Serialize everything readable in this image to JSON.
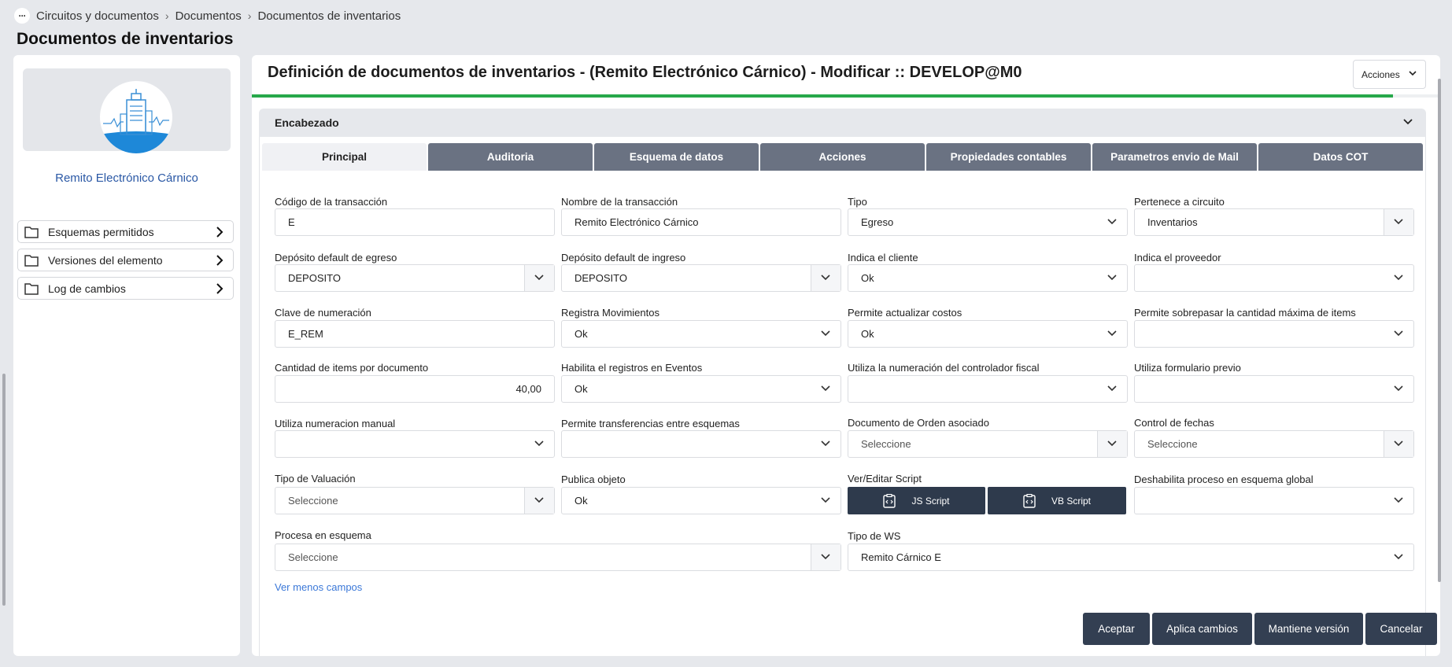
{
  "breadcrumb": {
    "menu_icon": "ellipsis-icon",
    "items": [
      "Circuitos y documentos",
      "Documentos",
      "Documentos de inventarios"
    ]
  },
  "page_title": "Documentos de inventarios",
  "sidebar": {
    "element_name": "Remito Electrónico Cárnico",
    "items": [
      {
        "label": "Esquemas permitidos",
        "icon": "folder-icon"
      },
      {
        "label": "Versiones del elemento",
        "icon": "folder-icon"
      },
      {
        "label": "Log de cambios",
        "icon": "folder-icon"
      }
    ]
  },
  "main": {
    "title": "Definición de documentos de inventarios - (Remito Electrónico Cárnico) - Modificar :: DEVELOP@M0",
    "actions_label": "Acciones",
    "progress_percent": 96,
    "section_title": "Encabezado",
    "tabs": [
      "Principal",
      "Auditoria",
      "Esquema de datos",
      "Acciones",
      "Propiedades contables",
      "Parametros envio de Mail",
      "Datos COT"
    ],
    "active_tab": "Principal",
    "fields": {
      "codigo": {
        "label": "Código de la transacción",
        "value": "E"
      },
      "nombre": {
        "label": "Nombre de la transacción",
        "value": "Remito Electrónico Cárnico"
      },
      "tipo": {
        "label": "Tipo",
        "value": "Egreso"
      },
      "pertenece": {
        "label": "Pertenece a circuito",
        "value": "Inventarios"
      },
      "dep_egreso": {
        "label": "Depósito default de egreso",
        "value": "DEPOSITO"
      },
      "dep_ingreso": {
        "label": "Depósito default de ingreso",
        "value": "DEPOSITO"
      },
      "indica_cliente": {
        "label": "Indica el cliente",
        "value": "Ok"
      },
      "indica_proveedor": {
        "label": "Indica el proveedor",
        "value": ""
      },
      "clave": {
        "label": "Clave de numeración",
        "value": "E_REM"
      },
      "registra_mov": {
        "label": "Registra Movimientos",
        "value": "Ok"
      },
      "actualizar_costos": {
        "label": "Permite actualizar costos",
        "value": "Ok"
      },
      "sobrepasar": {
        "label": "Permite sobrepasar la cantidad máxima de items",
        "value": ""
      },
      "cantidad_items": {
        "label": "Cantidad de items por documento",
        "value": "40,00"
      },
      "habilita_eventos": {
        "label": "Habilita el registros en Eventos",
        "value": "Ok"
      },
      "controlador_fiscal": {
        "label": "Utiliza la numeración del controlador fiscal",
        "value": ""
      },
      "formulario_previo": {
        "label": "Utiliza formulario previo",
        "value": ""
      },
      "numeracion_manual": {
        "label": "Utiliza numeracion manual",
        "value": ""
      },
      "transferencias": {
        "label": "Permite transferencias entre esquemas",
        "value": ""
      },
      "doc_orden": {
        "label": "Documento de Orden asociado",
        "value": "Seleccione"
      },
      "control_fechas": {
        "label": "Control de fechas",
        "value": "Seleccione"
      },
      "tipo_valuacion": {
        "label": "Tipo de Valuación",
        "value": "Seleccione"
      },
      "publica_objeto": {
        "label": "Publica objeto",
        "value": "Ok"
      },
      "script": {
        "label": "Ver/Editar Script",
        "js_label": "JS Script",
        "vb_label": "VB Script"
      },
      "deshabilita": {
        "label": "Deshabilita proceso en esquema global",
        "value": ""
      },
      "procesa_esquema": {
        "label": "Procesa en esquema",
        "value": "Seleccione"
      },
      "tipo_ws": {
        "label": "Tipo de WS",
        "value": "Remito Cárnico E"
      }
    },
    "ver_menos": "Ver menos campos"
  },
  "footer": {
    "aceptar": "Aceptar",
    "aplica": "Aplica cambios",
    "mantiene": "Mantiene versión",
    "cancelar": "Cancelar"
  },
  "colors": {
    "tab_bg": "#6a7282",
    "dark_button": "#333f52",
    "progress": "#27a84a",
    "link": "#3b78d8"
  }
}
